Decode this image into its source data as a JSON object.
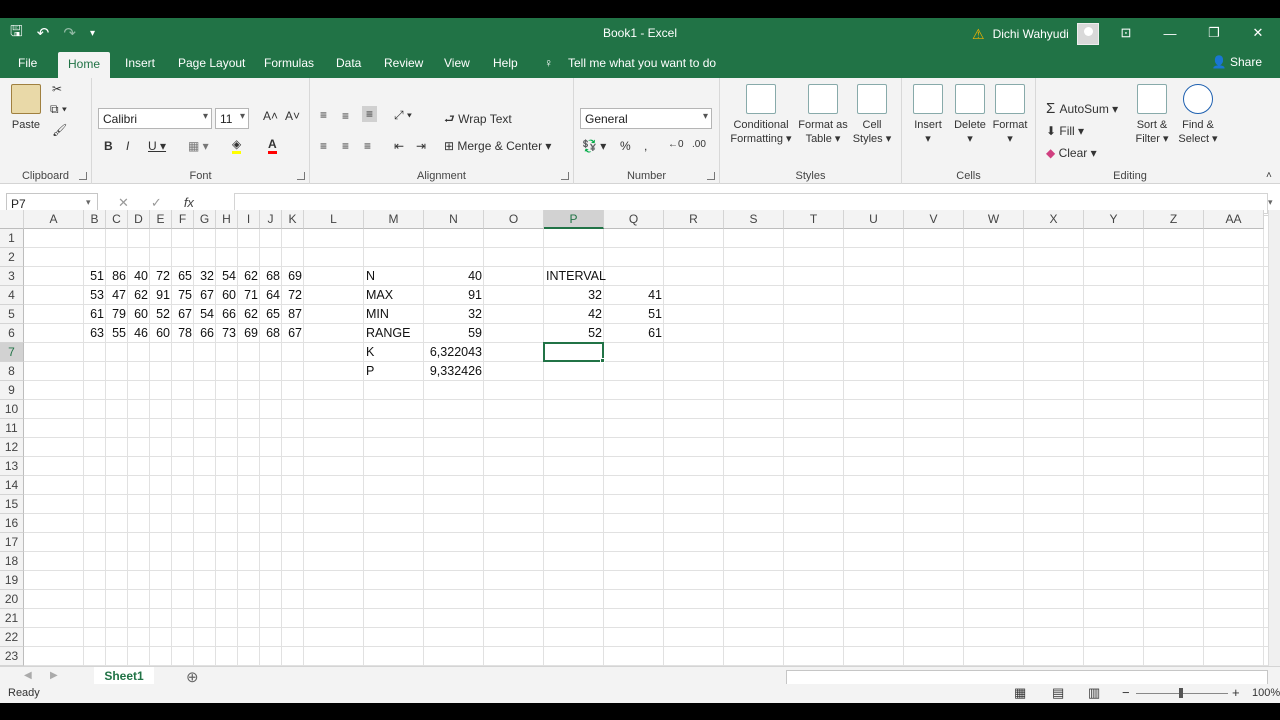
{
  "window": {
    "title": "Book1  -  Excel",
    "user": "Dichi Wahyudi"
  },
  "tabs": [
    "File",
    "Home",
    "Insert",
    "Page Layout",
    "Formulas",
    "Data",
    "Review",
    "View",
    "Help"
  ],
  "tell_me": "Tell me what you want to do",
  "share": "Share",
  "ribbon": {
    "clipboard": {
      "label": "Clipboard",
      "paste": "Paste"
    },
    "font": {
      "label": "Font",
      "name": "Calibri",
      "size": "11"
    },
    "alignment": {
      "label": "Alignment",
      "wrap": "Wrap Text",
      "merge": "Merge & Center"
    },
    "number": {
      "label": "Number",
      "format": "General"
    },
    "styles": {
      "label": "Styles",
      "cond1": "Conditional",
      "cond2": "Formatting",
      "fmt1": "Format as",
      "fmt2": "Table",
      "cell1": "Cell",
      "cell2": "Styles"
    },
    "cells": {
      "label": "Cells",
      "insert": "Insert",
      "delete": "Delete",
      "format": "Format"
    },
    "editing": {
      "label": "Editing",
      "autosum": "AutoSum",
      "fill": "Fill",
      "clear": "Clear",
      "sort1": "Sort &",
      "sort2": "Filter",
      "find1": "Find &",
      "find2": "Select"
    }
  },
  "namebox": "P7",
  "fx": "fx",
  "columns": [
    "A",
    "B",
    "C",
    "D",
    "E",
    "F",
    "G",
    "H",
    "I",
    "J",
    "K",
    "L",
    "M",
    "N",
    "O",
    "P",
    "Q",
    "R",
    "S",
    "T",
    "U",
    "V",
    "W",
    "X",
    "Y",
    "Z",
    "AA"
  ],
  "rows": [
    "1",
    "2",
    "3",
    "4",
    "5",
    "6",
    "7",
    "8",
    "9",
    "10",
    "11",
    "12",
    "13",
    "14",
    "15",
    "16",
    "17",
    "18",
    "19",
    "20",
    "21",
    "22",
    "23"
  ],
  "cells": {
    "data_block": [
      [
        51,
        86,
        40,
        72,
        65,
        32,
        54,
        62,
        68,
        69
      ],
      [
        53,
        47,
        62,
        91,
        75,
        67,
        60,
        71,
        64,
        72
      ],
      [
        61,
        79,
        60,
        52,
        67,
        54,
        66,
        62,
        65,
        87
      ],
      [
        63,
        55,
        46,
        60,
        78,
        66,
        73,
        69,
        68,
        67
      ]
    ],
    "stats_labels": [
      "N",
      "MAX",
      "MIN",
      "RANGE",
      "K",
      "P"
    ],
    "stats_values": [
      "40",
      "91",
      "32",
      "59",
      "6,322043",
      "9,332426"
    ],
    "interval_header": "INTERVAL",
    "interval_lower": [
      "32",
      "42",
      "52"
    ],
    "interval_upper": [
      "41",
      "51",
      "61"
    ]
  },
  "sheet": {
    "name": "Sheet1"
  },
  "status": {
    "ready": "Ready",
    "zoom": "100%"
  },
  "colors": {
    "accent": "#217346"
  }
}
